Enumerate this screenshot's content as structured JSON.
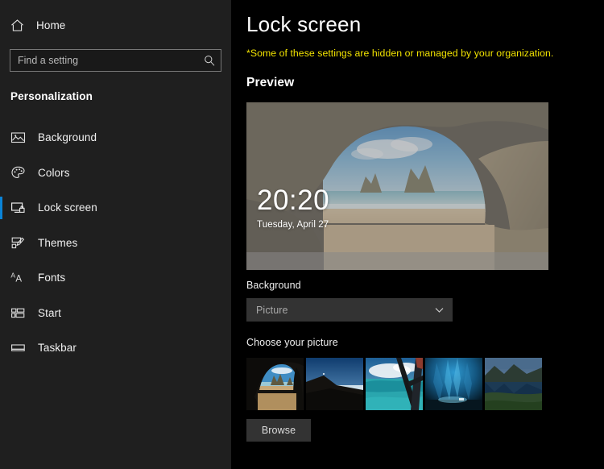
{
  "sidebar": {
    "home": {
      "label": "Home",
      "icon": "home-icon"
    },
    "search": {
      "placeholder": "Find a setting",
      "value": "",
      "icon": "search-icon"
    },
    "section_title": "Personalization",
    "items": [
      {
        "label": "Background",
        "icon": "picture-icon",
        "selected": false
      },
      {
        "label": "Colors",
        "icon": "palette-icon",
        "selected": false
      },
      {
        "label": "Lock screen",
        "icon": "lock-screen-icon",
        "selected": true
      },
      {
        "label": "Themes",
        "icon": "brush-icon",
        "selected": false
      },
      {
        "label": "Fonts",
        "icon": "font-icon",
        "selected": false
      },
      {
        "label": "Start",
        "icon": "start-tiles-icon",
        "selected": false
      },
      {
        "label": "Taskbar",
        "icon": "taskbar-icon",
        "selected": false
      }
    ]
  },
  "main": {
    "title": "Lock screen",
    "warning": "*Some of these settings are hidden or managed by your organization.",
    "preview_heading": "Preview",
    "preview": {
      "time": "20:20",
      "date": "Tuesday, April 27",
      "image_name": "cave-arch-beach"
    },
    "background": {
      "label": "Background",
      "selected": "Picture",
      "chevron_icon": "chevron-down-icon"
    },
    "choose_picture": {
      "label": "Choose your picture",
      "thumbnails": [
        {
          "name": "cave-arch-beach",
          "selected": true
        },
        {
          "name": "dark-ridge-snowfield",
          "selected": false
        },
        {
          "name": "lagoon-through-window",
          "selected": false
        },
        {
          "name": "blue-ice-cave",
          "selected": false
        },
        {
          "name": "mountain-lake-reflection",
          "selected": false
        }
      ]
    },
    "browse_button": "Browse"
  },
  "colors": {
    "accent": "#0a84d8",
    "sidebar_bg": "#1f1f1f",
    "content_bg": "#000000",
    "warning_text": "#f2e300",
    "control_bg": "#333333"
  }
}
